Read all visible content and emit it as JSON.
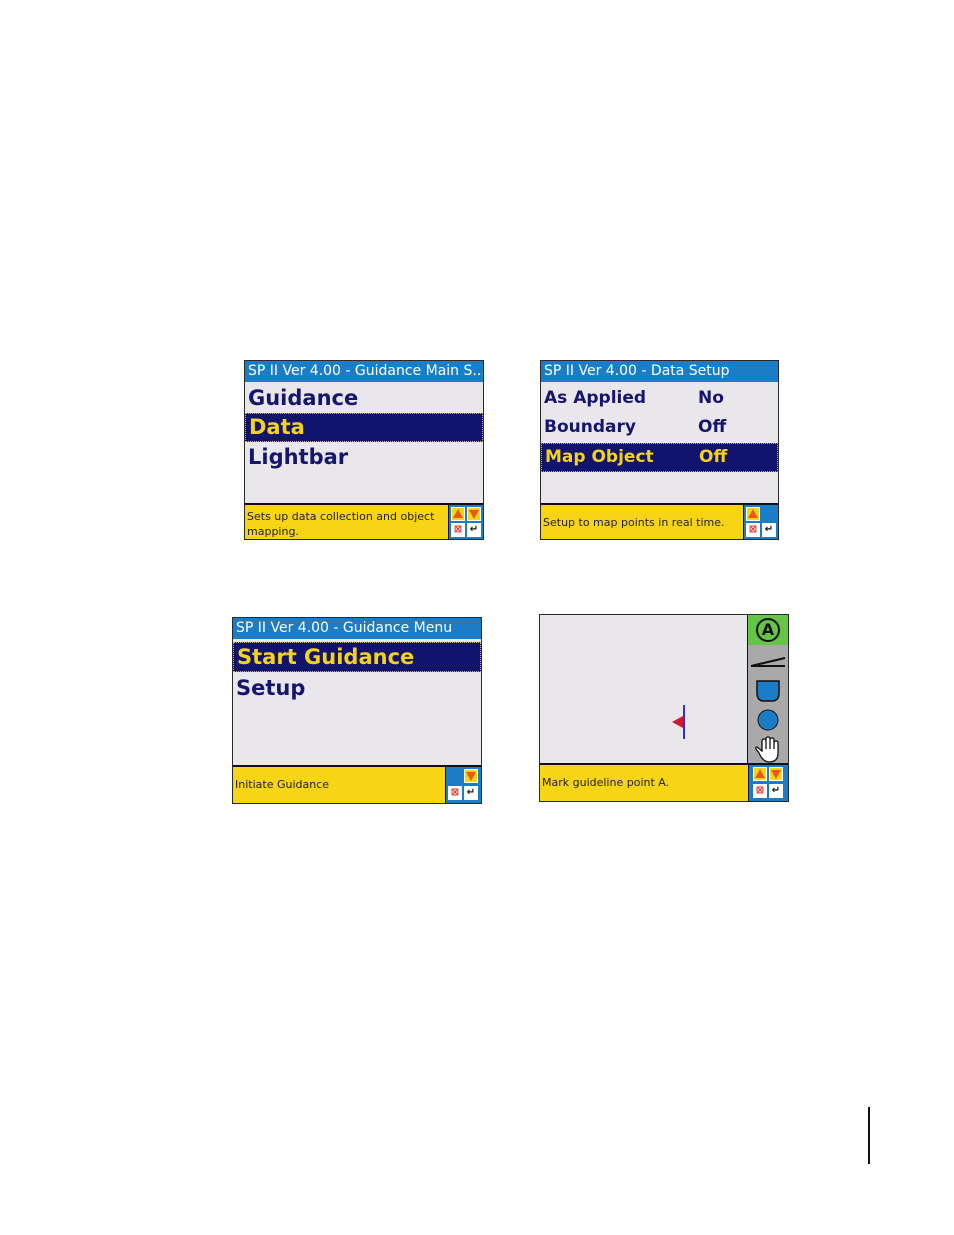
{
  "screen1": {
    "title": "SP II Ver 4.00 - Guidance Main S...",
    "items": [
      {
        "label": "Guidance"
      },
      {
        "label": "Data"
      },
      {
        "label": "Lightbar"
      }
    ],
    "selected_index": 1,
    "status": "Sets up data collection and object mapping."
  },
  "screen2": {
    "title": "SP II Ver 4.00 - Data Setup",
    "rows": [
      {
        "label": "As Applied",
        "value": "No"
      },
      {
        "label": "Boundary",
        "value": "Off"
      },
      {
        "label": "Map Object",
        "value": "Off"
      }
    ],
    "selected_index": 2,
    "status": "Setup to map points in real time."
  },
  "screen3": {
    "title": "SP II Ver 4.00 - Guidance Menu",
    "items": [
      {
        "label": "Start Guidance"
      },
      {
        "label": "Setup"
      }
    ],
    "selected_index": 0,
    "status": "Initiate Guidance"
  },
  "screen4": {
    "status": "Mark guideline point A.",
    "point_a_label": "A",
    "tools": [
      "point-a-icon",
      "line-icon",
      "boundary-icon",
      "circle-icon",
      "hand-icon"
    ]
  },
  "nav": {
    "cancel_glyph": "⊠",
    "enter_glyph": "↵"
  },
  "colors": {
    "titlebar": "#1b7dc6",
    "highlight": "#12136d",
    "highlight_text": "#f5d21c",
    "status_bar": "#f7d414",
    "menu_text": "#14166e"
  }
}
